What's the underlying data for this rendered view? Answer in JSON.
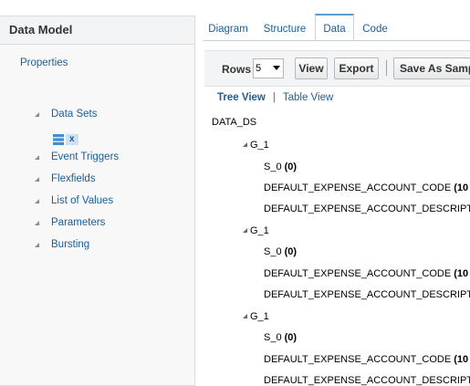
{
  "left": {
    "title": "Data Model",
    "properties": "Properties",
    "items": [
      {
        "label": "Data Sets"
      },
      {
        "label": "Event Triggers"
      },
      {
        "label": "Flexfields"
      },
      {
        "label": "List of Values"
      },
      {
        "label": "Parameters"
      },
      {
        "label": "Bursting"
      }
    ],
    "dataset_name": "x"
  },
  "tabs": [
    {
      "label": "Diagram"
    },
    {
      "label": "Structure"
    },
    {
      "label": "Data",
      "active": true
    },
    {
      "label": "Code"
    }
  ],
  "toolbar": {
    "rows_label": "Rows",
    "rows_value": "5",
    "view_label": "View",
    "export_label": "Export",
    "save_label": "Save As Sample Data"
  },
  "views": {
    "tree": "Tree View",
    "separator": "|",
    "table": "Table View"
  },
  "tree": {
    "root": "DATA_DS",
    "groups": [
      {
        "name": "G_1",
        "s0": "S_0",
        "s0_val": "(0)",
        "code": "DEFAULT_EXPENSE_ACCOUNT_CODE",
        "code_val": "(10",
        "desc": "DEFAULT_EXPENSE_ACCOUNT_DESCRIPTION"
      },
      {
        "name": "G_1",
        "s0": "S_0",
        "s0_val": "(0)",
        "code": "DEFAULT_EXPENSE_ACCOUNT_CODE",
        "code_val": "(10",
        "desc": "DEFAULT_EXPENSE_ACCOUNT_DESCRIPTION"
      },
      {
        "name": "G_1",
        "s0": "S_0",
        "s0_val": "(0)",
        "code": "DEFAULT_EXPENSE_ACCOUNT_CODE",
        "code_val": "(10",
        "desc": "DEFAULT_EXPENSE_ACCOUNT_DESCRIPTION"
      }
    ]
  }
}
